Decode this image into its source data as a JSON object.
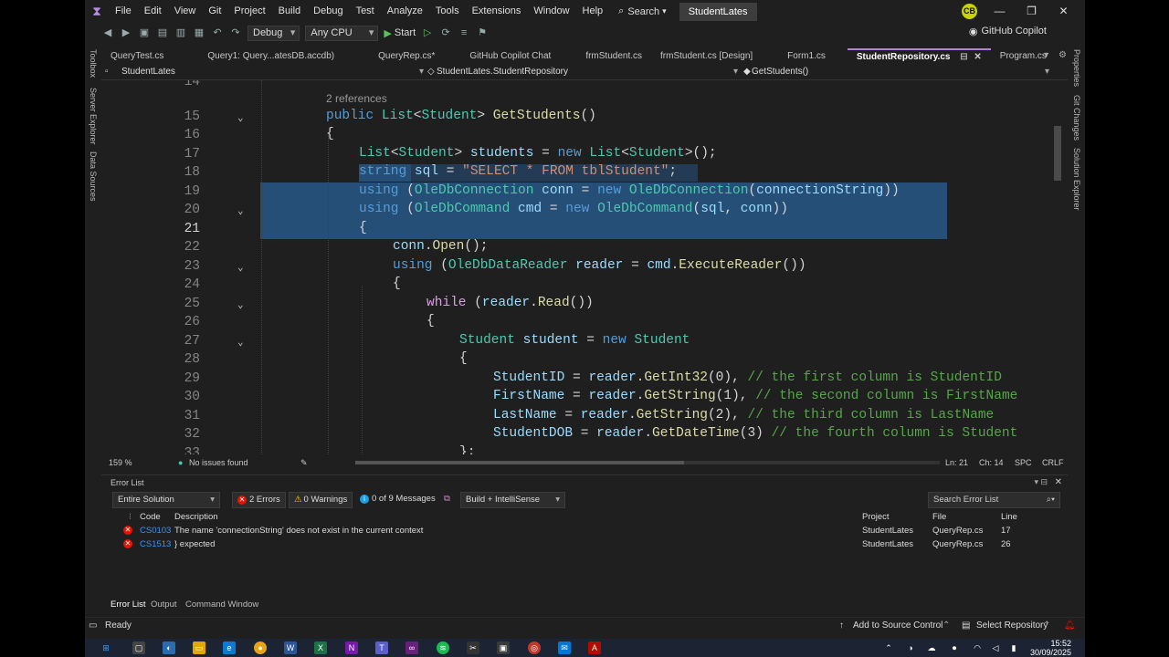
{
  "menubar": {
    "items": [
      "File",
      "Edit",
      "View",
      "Git",
      "Project",
      "Build",
      "Debug",
      "Test",
      "Analyze",
      "Tools",
      "Extensions",
      "Window",
      "Help"
    ],
    "search_label": "Search",
    "app_name": "StudentLates",
    "avatar": "CB"
  },
  "toolbar": {
    "config": "Debug",
    "platform": "Any CPU",
    "start_label": "Start",
    "copilot_label": "GitHub Copilot"
  },
  "left_panels": [
    "Toolbox",
    "Server Explorer",
    "Data Sources"
  ],
  "right_panels": [
    "Properties",
    "Git Changes",
    "Solution Explorer"
  ],
  "tabs": [
    {
      "label": "QueryTest.cs"
    },
    {
      "label": "Query1: Query...atesDB.accdb)"
    },
    {
      "label": "QueryRep.cs*"
    },
    {
      "label": "GitHub Copilot Chat"
    },
    {
      "label": "frmStudent.cs"
    },
    {
      "label": "frmStudent.cs [Design]"
    },
    {
      "label": "Form1.cs"
    },
    {
      "label": "StudentRepository.cs"
    },
    {
      "label": "Program.cs"
    }
  ],
  "navbar": {
    "project": "StudentLates",
    "class": "StudentLates.StudentRepository",
    "member": "GetStudents()"
  },
  "editor": {
    "references": "2 references",
    "line_numbers": [
      "14",
      "15",
      "16",
      "17",
      "18",
      "19",
      "20",
      "21",
      "22",
      "23",
      "24",
      "25",
      "26",
      "27",
      "28",
      "29",
      "30",
      "31",
      "32",
      "33"
    ]
  },
  "editor_status": {
    "zoom": "159 %",
    "issues": "No issues found",
    "position": "Ln: 21",
    "column": "Ch: 14",
    "spc": "SPC",
    "eol": "CRLF"
  },
  "error_list": {
    "title": "Error List",
    "scope": "Entire Solution",
    "errors": "2 Errors",
    "warnings": "0 Warnings",
    "messages": "0 of 9 Messages",
    "build_filter": "Build + IntelliSense",
    "search_placeholder": "Search Error List",
    "headers": {
      "code": "Code",
      "description": "Description",
      "project": "Project",
      "file": "File",
      "line": "Line"
    },
    "rows": [
      {
        "code": "CS0103",
        "description": "The name 'connectionString' does not exist in the current context",
        "project": "StudentLates",
        "file": "QueryRep.cs",
        "line": "17"
      },
      {
        "code": "CS1513",
        "description": "} expected",
        "project": "StudentLates",
        "file": "QueryRep.cs",
        "line": "26"
      }
    ]
  },
  "bottom_tabs": [
    "Error List",
    "Output",
    "Command Window"
  ],
  "statusbar": {
    "state": "Ready",
    "source_control": "Add to Source Control",
    "repository": "Select Repository"
  },
  "taskbar": {
    "time": "15:52",
    "date": "30/09/2025"
  },
  "colors": {
    "accent": "#b180d7",
    "selection": "#264f78",
    "keyword": "#569cd6",
    "type": "#4ec9b0",
    "string": "#ce9178",
    "comment": "#57a64a",
    "error": "#e51400"
  }
}
